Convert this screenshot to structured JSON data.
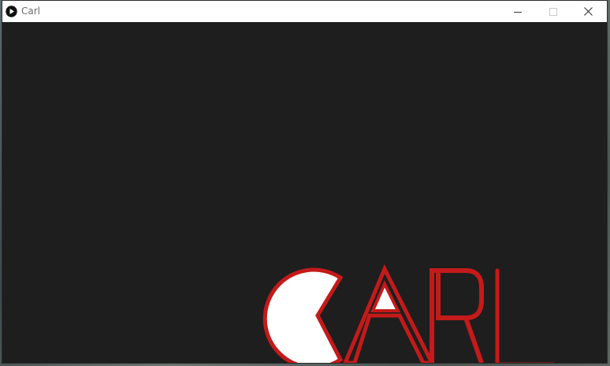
{
  "window": {
    "title": "Carl",
    "icon": "processing-play-icon",
    "controls": {
      "minimize": "minimize-icon",
      "maximize": "maximize-icon",
      "close": "close-icon"
    }
  },
  "canvas": {
    "background": "#1e1e1e",
    "logo": {
      "text": "CARL",
      "stroke_color": "#c41a1a",
      "fill_color": "#ffffff"
    }
  }
}
